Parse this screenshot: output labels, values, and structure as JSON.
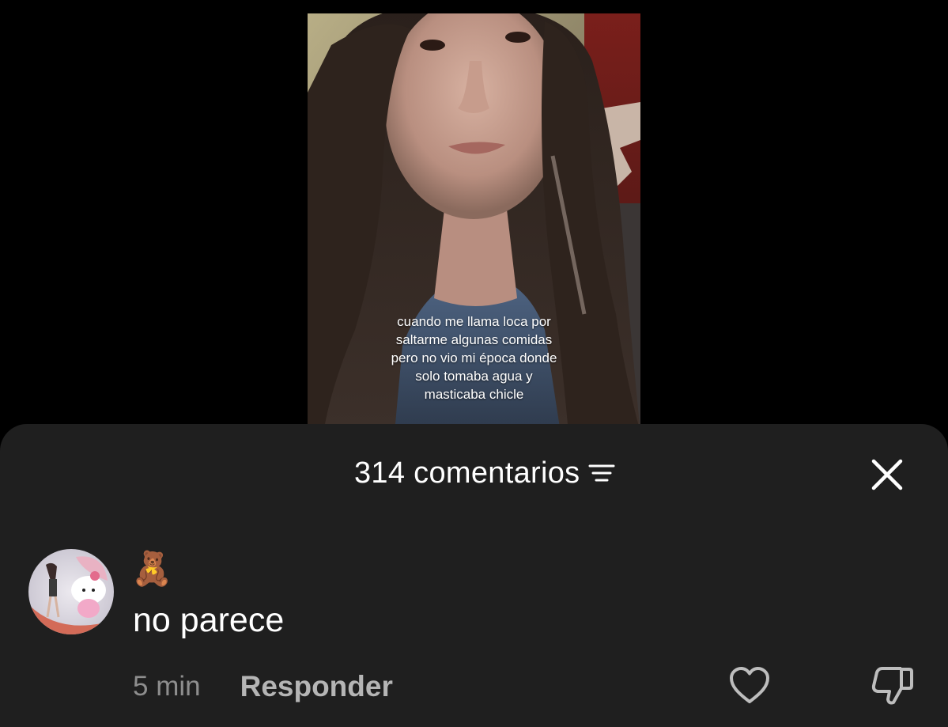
{
  "video": {
    "caption_lines": [
      "cuando me llama loca por",
      "saltarme algunas comidas",
      "pero no vio mi época donde",
      "solo tomaba agua y",
      "masticaba chicle"
    ]
  },
  "comments_sheet": {
    "count_label": "314 comentarios",
    "filter_icon": "sort-lines-icon",
    "close_icon": "close-x-icon"
  },
  "comment": {
    "username": "🧸",
    "text": "no parece",
    "timestamp": "5 min",
    "reply_label": "Responder",
    "like_icon": "heart-outline-icon",
    "dislike_icon": "thumbs-down-outline-icon"
  },
  "colors": {
    "background": "#000000",
    "sheet": "#1f1f1f",
    "primary_text": "#ffffff",
    "secondary_text": "#8e8e8e"
  }
}
